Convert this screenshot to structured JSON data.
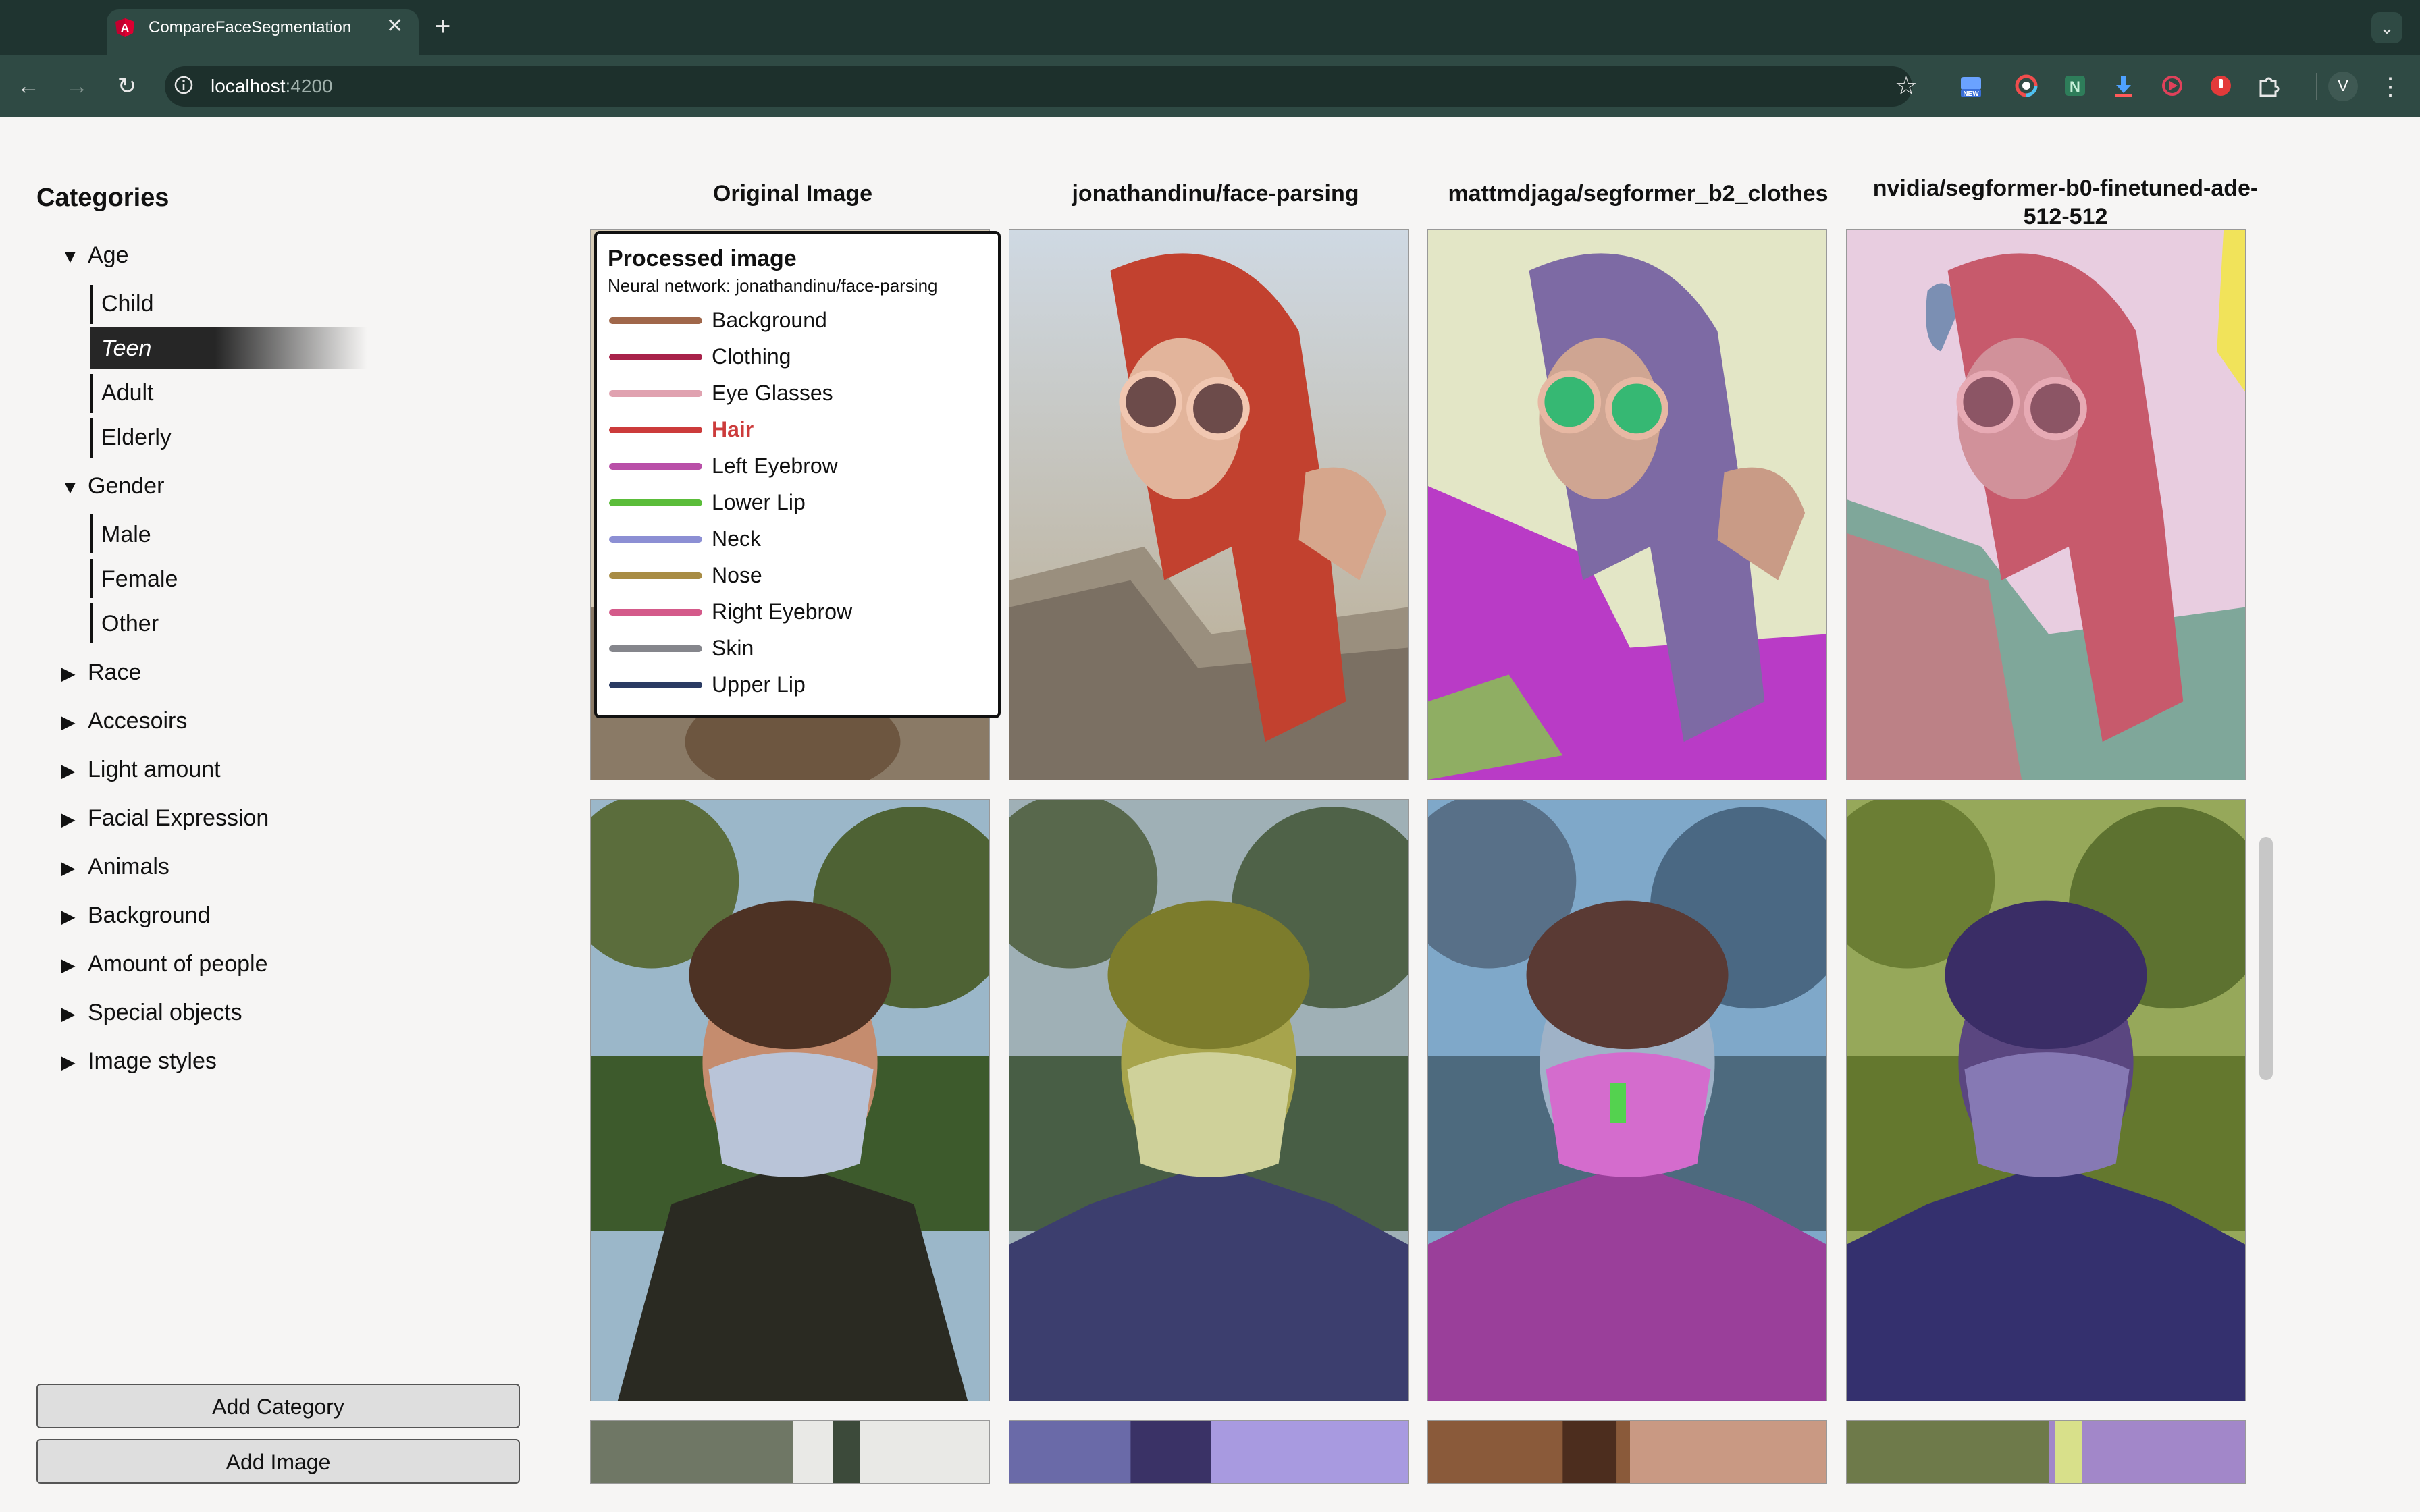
{
  "browser": {
    "tab_title": "CompareFaceSegmentation",
    "tab_close": "✕",
    "new_tab": "+",
    "tab_menu": "⌄",
    "url_host": "localhost",
    "url_port": ":4200",
    "profile_initial": "V",
    "back": "←",
    "forward": "→",
    "reload": "↻",
    "star": "☆",
    "menu": "⋮"
  },
  "sidebar": {
    "title": "Categories",
    "groups": [
      {
        "label": "Age",
        "expanded": true,
        "arrow": "▼",
        "items": [
          "Child",
          "Teen",
          "Adult",
          "Elderly"
        ],
        "selected": "Teen"
      },
      {
        "label": "Gender",
        "expanded": true,
        "arrow": "▼",
        "items": [
          "Male",
          "Female",
          "Other"
        ]
      },
      {
        "label": "Race",
        "arrow": "▶"
      },
      {
        "label": "Accesoirs",
        "arrow": "▶"
      },
      {
        "label": "Light amount",
        "arrow": "▶"
      },
      {
        "label": "Facial Expression",
        "arrow": "▶"
      },
      {
        "label": "Animals",
        "arrow": "▶"
      },
      {
        "label": "Background",
        "arrow": "▶"
      },
      {
        "label": "Amount of people",
        "arrow": "▶"
      },
      {
        "label": "Special objects",
        "arrow": "▶"
      },
      {
        "label": "Image styles",
        "arrow": "▶"
      }
    ],
    "add_category": "Add Category",
    "add_image": "Add Image"
  },
  "grid": {
    "columns": [
      "Original Image",
      "jonathandinu/face-parsing",
      "mattmdjaga/segformer_b2_clothes",
      "nvidia/segformer-b0-finetuned-ade-512-512"
    ]
  },
  "legend": {
    "title": "Processed image",
    "subtitle": "Neural network: jonathandinu/face-parsing",
    "active": "Hair",
    "items": [
      {
        "label": "Background",
        "color": "#a0674a"
      },
      {
        "label": "Clothing",
        "color": "#a8224a"
      },
      {
        "label": "Eye Glasses",
        "color": "#e0a2b0"
      },
      {
        "label": "Hair",
        "color": "#cc3b3b"
      },
      {
        "label": "Left Eyebrow",
        "color": "#b94fa8"
      },
      {
        "label": "Lower Lip",
        "color": "#5bbd3a"
      },
      {
        "label": "Neck",
        "color": "#8c8fd4"
      },
      {
        "label": "Nose",
        "color": "#a88c44"
      },
      {
        "label": "Right Eyebrow",
        "color": "#d45a8a"
      },
      {
        "label": "Skin",
        "color": "#85868c"
      },
      {
        "label": "Upper Lip",
        "color": "#2a3b63"
      }
    ]
  },
  "colors": {
    "chrome_dark": "#1f3430",
    "chrome_toolbar": "#2f4a44",
    "selected_item": "#262626"
  }
}
